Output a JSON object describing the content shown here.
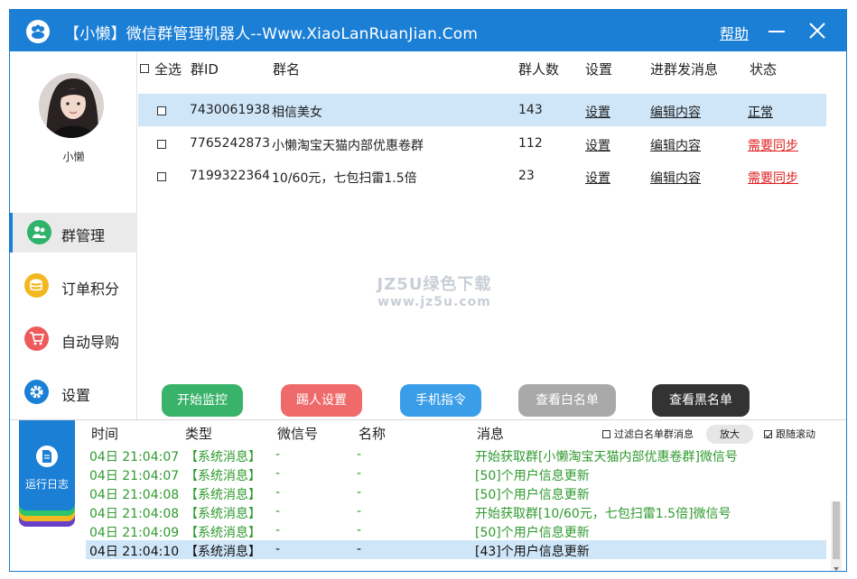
{
  "titlebar": {
    "title": "【小懒】微信群管理机器人--Www.XiaoLanRuanJian.Com",
    "help": "帮助"
  },
  "sidebar": {
    "username": "小懒",
    "items": [
      {
        "label": "群管理",
        "icon": "group-icon",
        "color": "#2fb36a"
      },
      {
        "label": "订单积分",
        "icon": "coins-icon",
        "color": "#f3b820"
      },
      {
        "label": "自动导购",
        "icon": "cart-icon",
        "color": "#ef5a5a"
      },
      {
        "label": "设置",
        "icon": "gear-icon",
        "color": "#1b7fd6"
      }
    ]
  },
  "group_table": {
    "headers": {
      "select_all": "全选",
      "id": "群ID",
      "name": "群名",
      "count": "群人数",
      "settings": "设置",
      "message": "进群发消息",
      "status": "状态"
    },
    "rows": [
      {
        "id": "7430061938",
        "name": "相信美女",
        "count": "143",
        "settings": "设置",
        "message": "编辑内容",
        "status": "正常"
      },
      {
        "id": "7765242873",
        "name": "小懒淘宝天猫内部优惠卷群",
        "count": "112",
        "settings": "设置",
        "message": "编辑内容",
        "status": "需要同步"
      },
      {
        "id": "7199322364",
        "name": "10/60元，七包扫雷1.5倍",
        "count": "23",
        "settings": "设置",
        "message": "编辑内容",
        "status": "需要同步"
      }
    ]
  },
  "watermark": {
    "line1": "JZ5U绿色下载",
    "line2": "www.jz5u.com"
  },
  "actions": {
    "start": "开始监控",
    "kick": "踢人设置",
    "phone": "手机指令",
    "whitelist": "查看白名单",
    "blacklist": "查看黑名单"
  },
  "log": {
    "tab_label": "运行日志",
    "headers": {
      "time": "时间",
      "type": "类型",
      "wechat": "微信号",
      "name": "名称",
      "message": "消息"
    },
    "filter_label": "过滤白名单群消息",
    "zoom_label": "放大",
    "follow_label": "跟随滚动",
    "rows": [
      {
        "time": "04日 21:04:07",
        "type": "【系统消息】",
        "wechat": "-",
        "name": "-",
        "message": "开始获取群[小懒淘宝天猫内部优惠卷群]微信号"
      },
      {
        "time": "04日 21:04:07",
        "type": "【系统消息】",
        "wechat": "-",
        "name": "-",
        "message": "[50]个用户信息更新"
      },
      {
        "time": "04日 21:04:08",
        "type": "【系统消息】",
        "wechat": "-",
        "name": "-",
        "message": "[50]个用户信息更新"
      },
      {
        "time": "04日 21:04:08",
        "type": "【系统消息】",
        "wechat": "-",
        "name": "-",
        "message": "开始获取群[10/60元，七包扫雷1.5倍]微信号"
      },
      {
        "time": "04日 21:04:09",
        "type": "【系统消息】",
        "wechat": "-",
        "name": "-",
        "message": "[50]个用户信息更新"
      },
      {
        "time": "04日 21:04:10",
        "type": "【系统消息】",
        "wechat": "-",
        "name": "-",
        "message": "[43]个用户信息更新"
      }
    ]
  }
}
